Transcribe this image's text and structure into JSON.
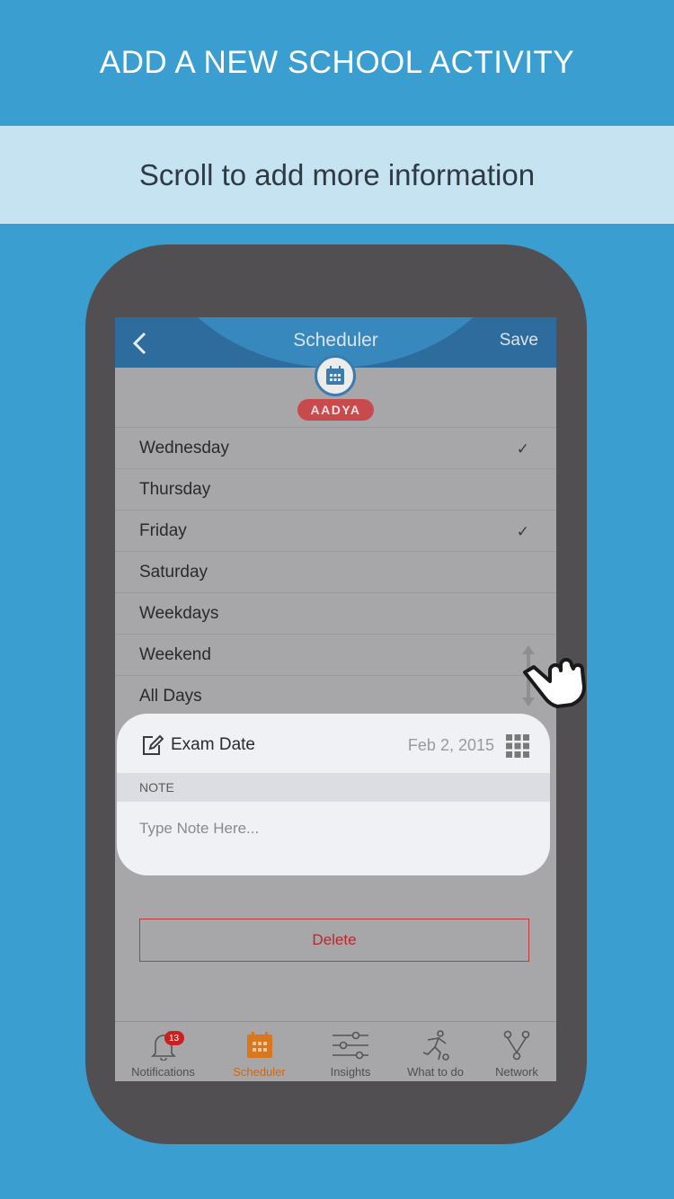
{
  "promo": {
    "headline": "ADD A NEW SCHOOL ACTIVITY",
    "subheadline": "Scroll to add more information"
  },
  "app": {
    "header": {
      "title": "Scheduler",
      "save_label": "Save",
      "back_icon": "chevron-left-icon"
    },
    "brand": {
      "logo_text": "AADYA",
      "icon": "calendar-icon"
    },
    "days": [
      {
        "label": "Wednesday",
        "checked": true
      },
      {
        "label": "Thursday",
        "checked": false
      },
      {
        "label": "Friday",
        "checked": true
      },
      {
        "label": "Saturday",
        "checked": false
      },
      {
        "label": "Weekdays",
        "checked": false
      },
      {
        "label": "Weekend",
        "checked": false
      },
      {
        "label": "All Days",
        "checked": false
      }
    ],
    "check_glyph": "✓",
    "exam": {
      "label": "Exam Date",
      "date": "Feb 2, 2015",
      "icon": "edit-icon",
      "picker_icon": "grid-icon"
    },
    "note": {
      "header": "NOTE",
      "placeholder": "Type Note Here..."
    },
    "delete_label": "Delete",
    "tabs": [
      {
        "label": "Notifications",
        "icon": "bell-icon",
        "badge": "13",
        "active": false
      },
      {
        "label": "Scheduler",
        "icon": "calendar-icon",
        "active": true
      },
      {
        "label": "Insights",
        "icon": "sliders-icon",
        "active": false
      },
      {
        "label": "What to do",
        "icon": "activity-icon",
        "active": false
      },
      {
        "label": "Network",
        "icon": "network-icon",
        "active": false
      }
    ]
  },
  "colors": {
    "background": "#3a9ed0",
    "header_bar": "#2e6c9d",
    "brand_red": "#c94a4c",
    "active_tab": "#c76a19",
    "delete_red": "#c0383b"
  }
}
